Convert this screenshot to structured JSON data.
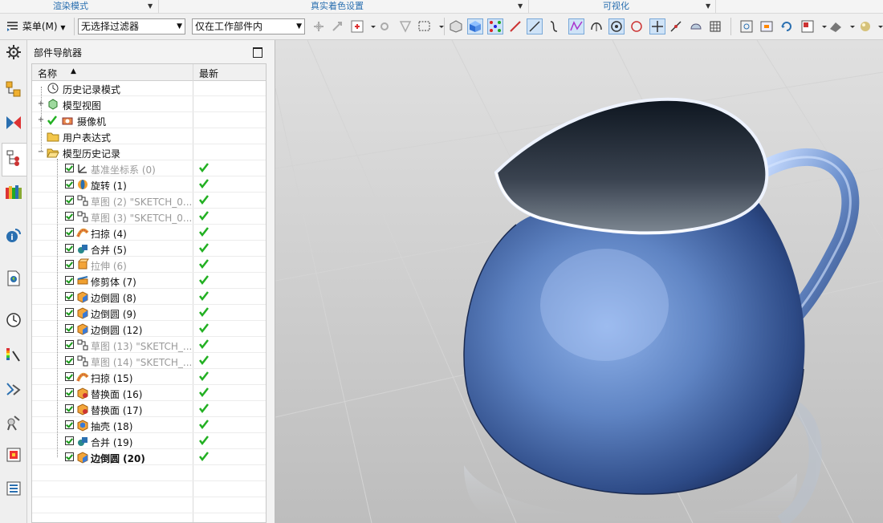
{
  "ribbon_groups": [
    {
      "label": "渲染模式"
    },
    {
      "label": "真实着色设置"
    },
    {
      "label": "可视化"
    }
  ],
  "toolbar": {
    "menu_label": "菜单(M)",
    "selection_filter": "无选择过滤器",
    "selection_scope": "仅在工作部件内"
  },
  "navigator": {
    "title": "部件导航器",
    "col_name": "名称",
    "col_latest": "最新",
    "items": [
      {
        "label": "历史记录模式",
        "icon": "clock-icon"
      },
      {
        "label": "模型视图",
        "icon": "model-view-icon"
      },
      {
        "label": "摄像机",
        "icon": "camera-icon"
      },
      {
        "label": "用户表达式",
        "icon": "folder-icon"
      },
      {
        "label": "模型历史记录",
        "icon": "folder-open-icon"
      }
    ],
    "features": [
      {
        "label": "基准坐标系 (0)",
        "icon": "datum-csys-icon",
        "dim": true
      },
      {
        "label": "旋转 (1)",
        "icon": "revolve-icon"
      },
      {
        "label": "草图 (2) \"SKETCH_0...",
        "icon": "sketch-icon",
        "dim": true
      },
      {
        "label": "草图 (3) \"SKETCH_0...",
        "icon": "sketch-icon",
        "dim": true
      },
      {
        "label": "扫掠 (4)",
        "icon": "sweep-icon"
      },
      {
        "label": "合并 (5)",
        "icon": "unite-icon"
      },
      {
        "label": "拉伸 (6)",
        "icon": "extrude-icon",
        "dim": true
      },
      {
        "label": "修剪体 (7)",
        "icon": "trim-body-icon"
      },
      {
        "label": "边倒圆 (8)",
        "icon": "edge-blend-icon"
      },
      {
        "label": "边倒圆 (9)",
        "icon": "edge-blend-icon"
      },
      {
        "label": "边倒圆 (12)",
        "icon": "edge-blend-icon"
      },
      {
        "label": "草图 (13) \"SKETCH_...",
        "icon": "sketch-icon",
        "dim": true
      },
      {
        "label": "草图 (14) \"SKETCH_...",
        "icon": "sketch-icon",
        "dim": true
      },
      {
        "label": "扫掠 (15)",
        "icon": "sweep-icon"
      },
      {
        "label": "替换面 (16)",
        "icon": "replace-face-icon"
      },
      {
        "label": "替换面 (17)",
        "icon": "replace-face-icon"
      },
      {
        "label": "抽壳 (18)",
        "icon": "shell-icon"
      },
      {
        "label": "合并 (19)",
        "icon": "unite-icon"
      },
      {
        "label": "边倒圆 (20)",
        "icon": "edge-blend-icon",
        "bold": true
      }
    ]
  },
  "viewport": {
    "object": "pitcher"
  },
  "colors": {
    "ribbon_label": "#2a6fb0",
    "latest_check": "#22b022",
    "model_blue": "#5a7fb8"
  }
}
